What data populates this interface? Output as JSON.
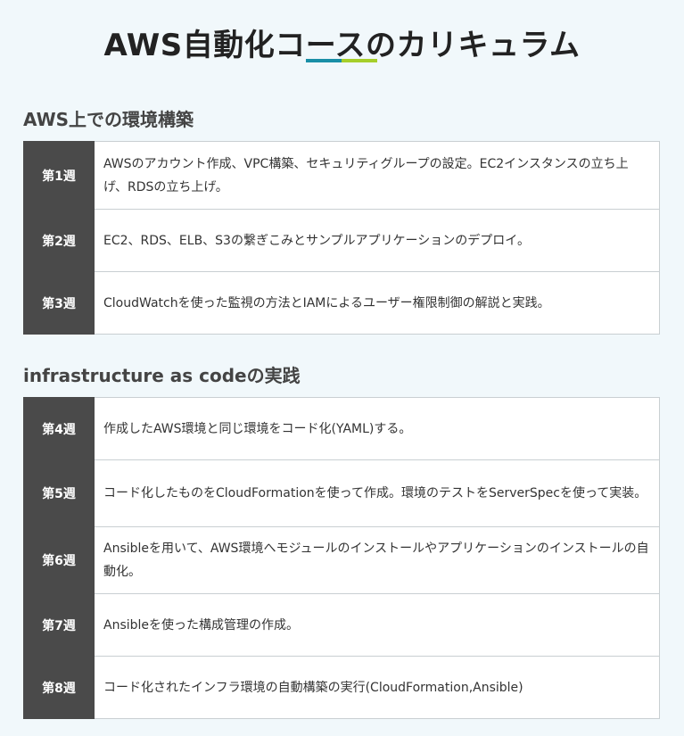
{
  "page": {
    "title": "AWS自動化コースのカリキュラム",
    "underline_colors": [
      "#1a8fa6",
      "#a6cf2a"
    ]
  },
  "sections": [
    {
      "heading": "AWS上での環境構築",
      "rows": [
        {
          "week": "第1週",
          "description": "AWSのアカウント作成、VPC構築、セキュリティグループの設定。EC2インスタンスの立ち上げ、RDSの立ち上げ。"
        },
        {
          "week": "第2週",
          "description": "EC2、RDS、ELB、S3の繋ぎこみとサンプルアプリケーションのデプロイ。"
        },
        {
          "week": "第3週",
          "description": "CloudWatchを使った監視の方法とIAMによるユーザー権限制御の解説と実践。"
        }
      ]
    },
    {
      "heading": "infrastructure as codeの実践",
      "rows": [
        {
          "week": "第4週",
          "description": "作成したAWS環境と同じ環境をコード化(YAML)する。"
        },
        {
          "week": "第5週",
          "description": "コード化したものをCloudFormationを使って作成。環境のテストをServerSpecを使って実装。"
        },
        {
          "week": "第6週",
          "description": "Ansibleを用いて、AWS環境へモジュールのインストールやアプリケーションのインストールの自動化。"
        },
        {
          "week": "第7週",
          "description": "Ansibleを使った構成管理の作成。"
        },
        {
          "week": "第8週",
          "description": "コード化されたインフラ環境の自動構築の実行(CloudFormation,Ansible)"
        }
      ]
    }
  ]
}
